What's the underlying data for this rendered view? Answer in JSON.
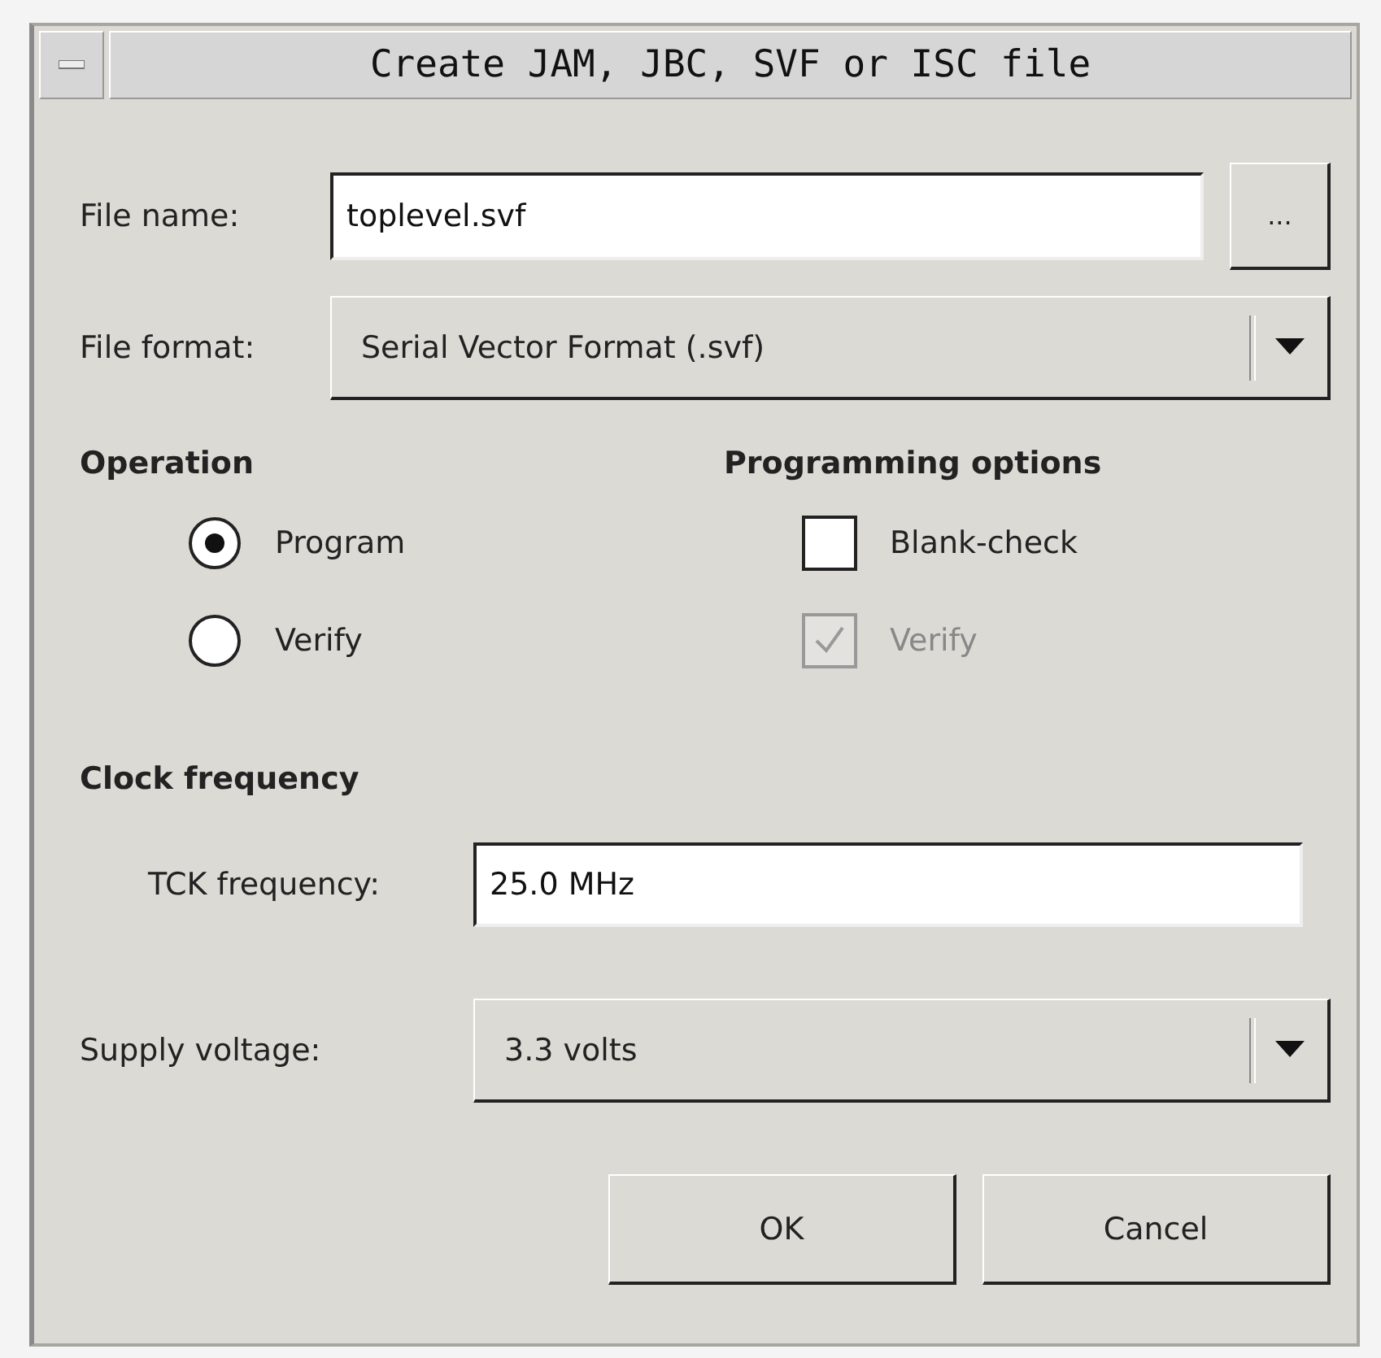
{
  "window": {
    "title": "Create JAM, JBC, SVF or ISC file"
  },
  "file_name": {
    "label": "File name:",
    "value": "toplevel.svf",
    "browse": "..."
  },
  "file_format": {
    "label": "File format:",
    "value": "Serial Vector Format (.svf)"
  },
  "operation": {
    "heading": "Operation",
    "options": [
      {
        "label": "Program",
        "selected": true
      },
      {
        "label": "Verify",
        "selected": false
      }
    ]
  },
  "programming_options": {
    "heading": "Programming options",
    "options": [
      {
        "label": "Blank-check",
        "checked": false,
        "disabled": false
      },
      {
        "label": "Verify",
        "checked": true,
        "disabled": true
      }
    ]
  },
  "clock": {
    "heading": "Clock frequency",
    "label": "TCK frequency:",
    "value": "25.0 MHz"
  },
  "supply": {
    "label": "Supply voltage:",
    "value": "3.3 volts"
  },
  "buttons": [
    "OK",
    "Cancel"
  ]
}
